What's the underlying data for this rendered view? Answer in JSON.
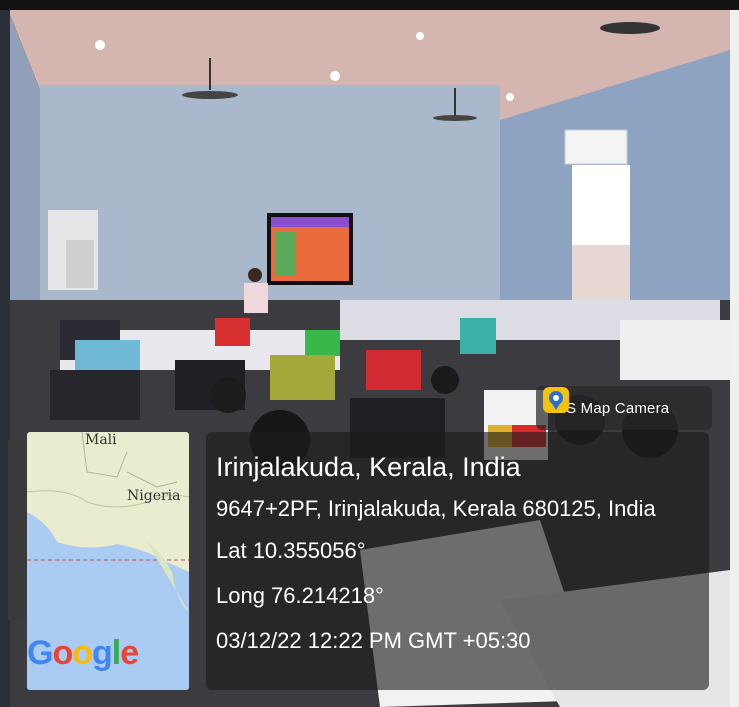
{
  "overlay": {
    "app_badge": "GPS Map Camera",
    "place": "Irinjalakuda, Kerala, India",
    "address": "9647+2PF, Irinjalakuda, Kerala 680125, India",
    "latitude": "Lat 10.355056°",
    "longitude": "Long 76.214218°",
    "datetime": "03/12/22 12:22 PM GMT +05:30"
  },
  "map": {
    "labels": [
      "Mali",
      "Nigeria"
    ],
    "logo": "Google",
    "logo_colors": [
      "#4285F4",
      "#EA4335",
      "#FBBC05",
      "#4285F4",
      "#34A853",
      "#EA4335"
    ]
  },
  "icons": [
    "location-pin-icon"
  ]
}
